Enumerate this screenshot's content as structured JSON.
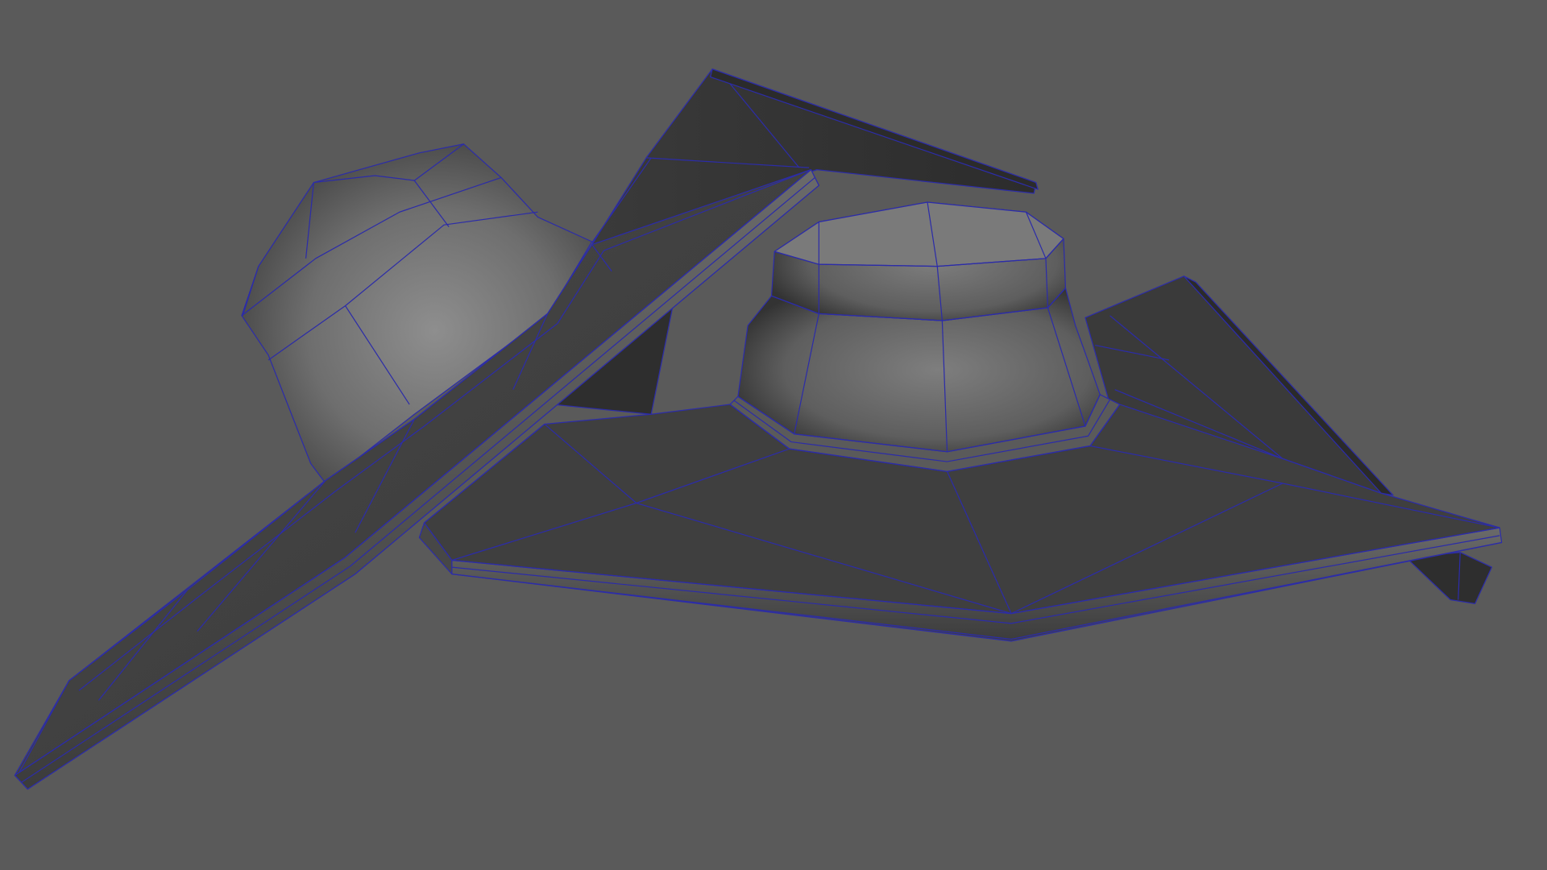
{
  "viewport": {
    "background_color": "#5a5a5a",
    "wire_color": "#2c2ca8",
    "objects": [
      "hat-left",
      "hat-right"
    ]
  }
}
